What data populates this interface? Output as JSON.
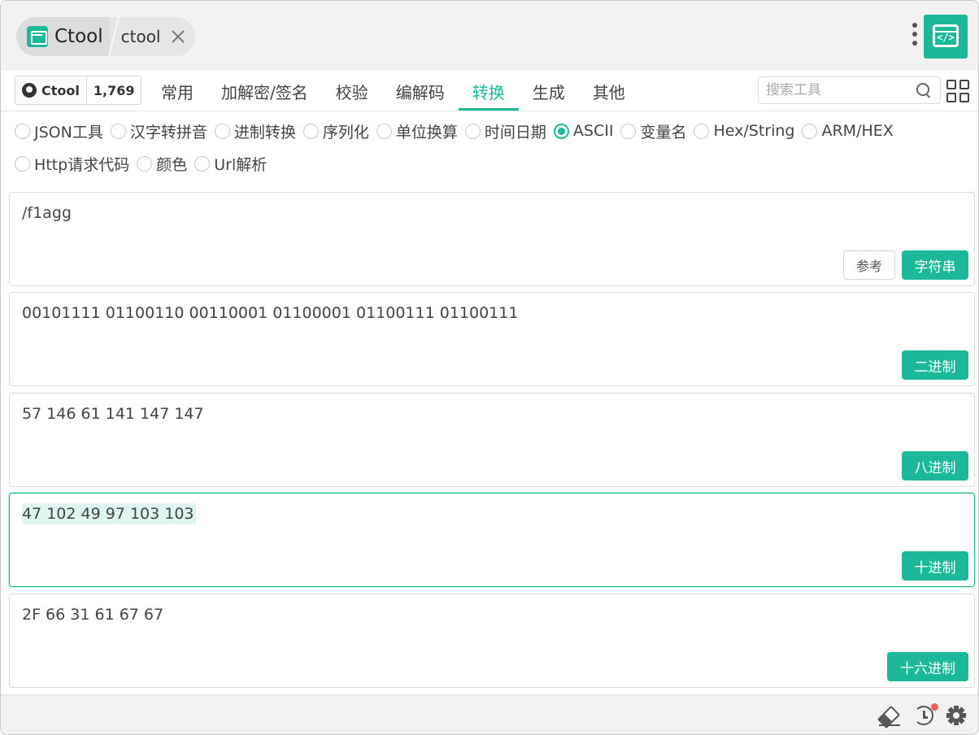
{
  "titlebar": {
    "app_name": "Ctool",
    "current_tool": "ctool"
  },
  "nav": {
    "github": {
      "label": "Ctool",
      "stars": "1,769"
    },
    "tabs": [
      {
        "label": "常用",
        "active": false
      },
      {
        "label": "加解密/签名",
        "active": false
      },
      {
        "label": "校验",
        "active": false
      },
      {
        "label": "编解码",
        "active": false
      },
      {
        "label": "转换",
        "active": true
      },
      {
        "label": "生成",
        "active": false
      },
      {
        "label": "其他",
        "active": false
      }
    ],
    "search_placeholder": "搜索工具"
  },
  "features": [
    {
      "label": "JSON工具",
      "checked": false
    },
    {
      "label": "汉字转拼音",
      "checked": false
    },
    {
      "label": "进制转换",
      "checked": false
    },
    {
      "label": "序列化",
      "checked": false
    },
    {
      "label": "单位换算",
      "checked": false
    },
    {
      "label": "时间日期",
      "checked": false
    },
    {
      "label": "ASCII",
      "checked": true
    },
    {
      "label": "变量名",
      "checked": false
    },
    {
      "label": "Hex/String",
      "checked": false
    },
    {
      "label": "ARM/HEX",
      "checked": false
    },
    {
      "label": "Http请求代码",
      "checked": false
    },
    {
      "label": "颜色",
      "checked": false
    },
    {
      "label": "Url解析",
      "checked": false
    }
  ],
  "panels": {
    "string": {
      "value": "/f1agg",
      "ref_label": "参考",
      "type_label": "字符串"
    },
    "binary": {
      "value": "00101111 01100110 00110001 01100001 01100111 01100111",
      "type_label": "二进制"
    },
    "octal": {
      "value": "57 146 61 141 147 147",
      "type_label": "八进制"
    },
    "decimal": {
      "value": "47 102 49 97 103 103",
      "type_label": "十进制"
    },
    "hex": {
      "value": "2F 66 31 61 67 67",
      "type_label": "十六进制"
    }
  },
  "colors": {
    "accent": "#1bb99a",
    "notification": "#f25c5c"
  },
  "icons": [
    "ctool-logo-icon",
    "close-icon",
    "more-vert-icon",
    "code-window-icon",
    "github-icon",
    "search-icon",
    "grid-icon",
    "eraser-icon",
    "history-icon",
    "gear-icon"
  ]
}
